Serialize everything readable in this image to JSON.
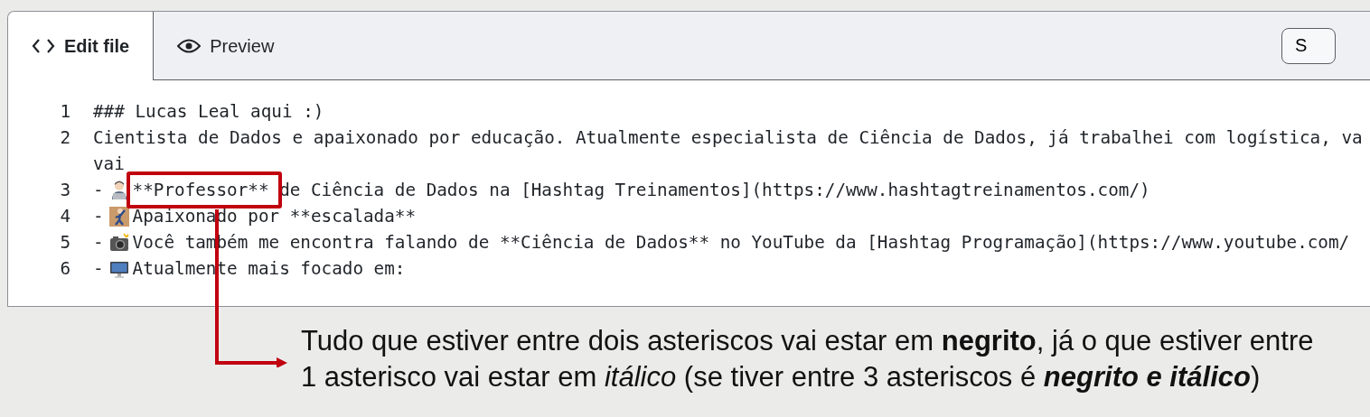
{
  "editor": {
    "tabs": [
      {
        "label": "Edit file",
        "selected": true
      },
      {
        "label": "Preview",
        "selected": false
      }
    ],
    "toolbar_button": "S",
    "lines": [
      {
        "number": "1",
        "text": "### Lucas Leal aqui :)"
      },
      {
        "number": "2",
        "text": "Cientista de Dados e apaixonado por educação. Atualmente especialista de Ciência de Dados, já trabalhei com logística, va",
        "wrap": "vai"
      },
      {
        "number": "3",
        "bullet": "-",
        "highlight": "**Professor**",
        "text": " de Ciência de Dados na [Hashtag Treinamentos](https://www.hashtagtreinamentos.com/)"
      },
      {
        "number": "4",
        "bullet": "-",
        "text": "Apaixonado por **escalada**"
      },
      {
        "number": "5",
        "bullet": "-",
        "text": "Você também me encontra falando de **Ciência de Dados** no YouTube da [Hashtag Programação](https://www.youtube.com/"
      },
      {
        "number": "6",
        "bullet": "-",
        "text": "Atualmente mais focado em:"
      }
    ]
  },
  "annotation": [
    {
      "text": "Tudo que estiver entre dois asteriscos vai estar em ",
      "bold": false,
      "italic": false
    },
    {
      "text": "negrito",
      "bold": true,
      "italic": false
    },
    {
      "text": ", já o que estiver entre 1 asterisco vai estar em ",
      "bold": false,
      "italic": false
    },
    {
      "text": "itálico",
      "bold": false,
      "italic": true
    },
    {
      "text": " (se tiver entre 3 asteriscos é ",
      "bold": false,
      "italic": false
    },
    {
      "text": "negrito e itálico",
      "bold": true,
      "italic": true
    },
    {
      "text": ")",
      "bold": false,
      "italic": false
    }
  ]
}
